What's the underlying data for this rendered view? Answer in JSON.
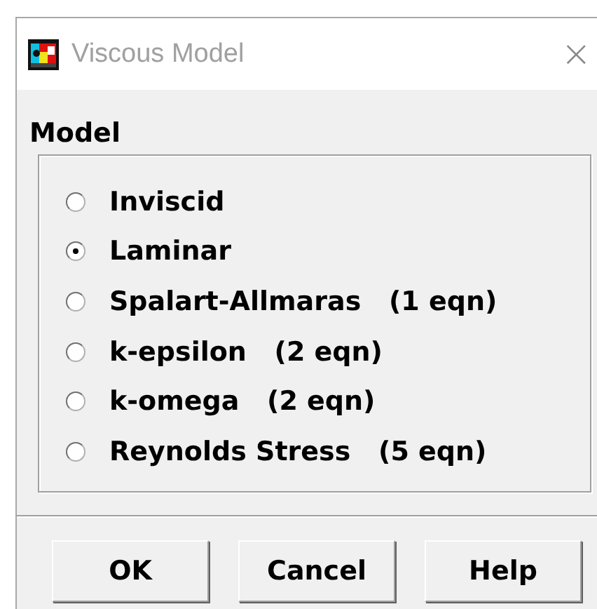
{
  "window": {
    "title": "Viscous Model",
    "close": "×"
  },
  "model": {
    "label": "Model",
    "options": [
      {
        "label": "Inviscid",
        "selected": false
      },
      {
        "label": "Laminar",
        "selected": true
      },
      {
        "label": "Spalart-Allmaras   (1 eqn)",
        "selected": false
      },
      {
        "label": "k-epsilon   (2 eqn)",
        "selected": false
      },
      {
        "label": "k-omega   (2 eqn)",
        "selected": false
      },
      {
        "label": "Reynolds Stress   (5 eqn)",
        "selected": false
      }
    ]
  },
  "buttons": [
    "OK",
    "Cancel",
    "Help"
  ]
}
